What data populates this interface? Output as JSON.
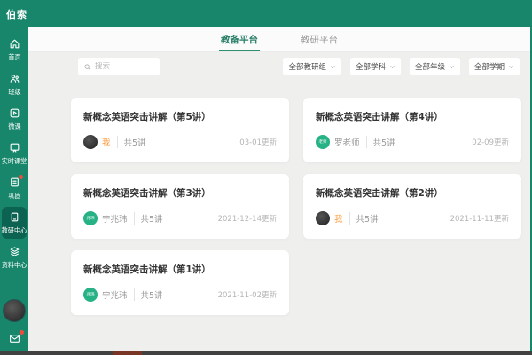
{
  "brand": "伯索",
  "sidebar": {
    "items": [
      {
        "label": "首页"
      },
      {
        "label": "班级"
      },
      {
        "label": "微课"
      },
      {
        "label": "实时课堂"
      },
      {
        "label": "巩固",
        "badge": true
      },
      {
        "label": "教研中心",
        "active": true
      },
      {
        "label": "资料中心"
      }
    ],
    "message": {
      "badge": true
    }
  },
  "header": {
    "tabs": [
      {
        "label": "教备平台",
        "active": true
      },
      {
        "label": "教研平台",
        "active": false
      }
    ]
  },
  "toolbar": {
    "search_placeholder": "搜索",
    "filters": [
      {
        "label": "全部教研组"
      },
      {
        "label": "全部学科"
      },
      {
        "label": "全部年级"
      },
      {
        "label": "全部学期"
      }
    ]
  },
  "cards": [
    {
      "title": "新概念英语突击讲解（第5讲）",
      "author": "我",
      "is_self": true,
      "avatar_text": "",
      "count": "共5讲",
      "updated": "03-01更新"
    },
    {
      "title": "新概念英语突击讲解（第4讲）",
      "author": "罗老师",
      "is_self": false,
      "avatar_text": "老师",
      "count": "共5讲",
      "updated": "02-09更新"
    },
    {
      "title": "新概念英语突击讲解（第3讲）",
      "author": "宁兆玮",
      "is_self": false,
      "avatar_text": "兆玮",
      "count": "共5讲",
      "updated": "2021-12-14更新"
    },
    {
      "title": "新概念英语突击讲解（第2讲）",
      "author": "我",
      "is_self": true,
      "avatar_text": "",
      "count": "共5讲",
      "updated": "2021-11-11更新"
    },
    {
      "title": "新概念英语突击讲解（第1讲）",
      "author": "宁兆玮",
      "is_self": false,
      "avatar_text": "兆玮",
      "count": "共5讲",
      "updated": "2021-11-02更新"
    }
  ],
  "colors": {
    "brand_green": "#17866b",
    "active_item_bg": "#0c6351",
    "accent_green": "#27b286",
    "self_orange": "#ff9c41",
    "badge_red": "#f5493d",
    "page_bg": "#efefee"
  }
}
